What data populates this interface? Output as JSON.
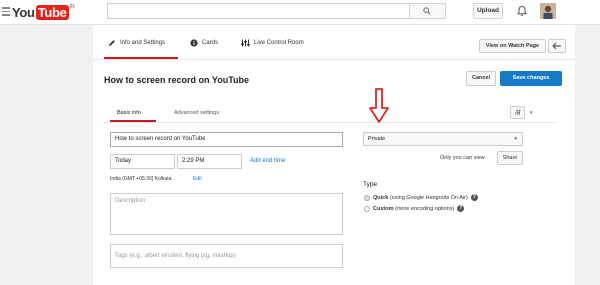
{
  "header": {
    "logo_you": "You",
    "logo_tube": "Tube",
    "logo_country": "IN",
    "search_placeholder": "",
    "upload_label": "Upload"
  },
  "tabs": [
    {
      "label": "Info and Settings"
    },
    {
      "label": "Cards"
    },
    {
      "label": "Live Control Room"
    }
  ],
  "toolbar": {
    "view_on_watch_page": "View on Watch Page",
    "cancel": "Cancel",
    "save_changes": "Save changes"
  },
  "page_title": "How to screen record on YouTube",
  "subtabs": [
    {
      "label": "Basic info"
    },
    {
      "label": "Advanced settings"
    }
  ],
  "form": {
    "title_value": "How to screen record on YouTube",
    "date_value": "Today",
    "time_value": "2:29 PM",
    "add_end_time": "Add end time",
    "timezone": "India (GMT +05:30) Kolkata",
    "timezone_edit": "Edit",
    "description_placeholder": "Description",
    "tags_placeholder": "Tags (e.g., albert einstein, flying pig, mashup)"
  },
  "privacy": {
    "selected": "Private",
    "note": "Only you can view",
    "share_label": "Share",
    "language_glyph": "अ"
  },
  "type_section": {
    "heading": "Type",
    "quick_bold": "Quick",
    "quick_rest": " (using Google Hangouts On Air)",
    "custom_bold": "Custom",
    "custom_rest": " (more encoding options)"
  },
  "colors": {
    "accent_red": "#cc181e",
    "brand_blue": "#167ac6",
    "arrow_red": "#e0242a"
  }
}
